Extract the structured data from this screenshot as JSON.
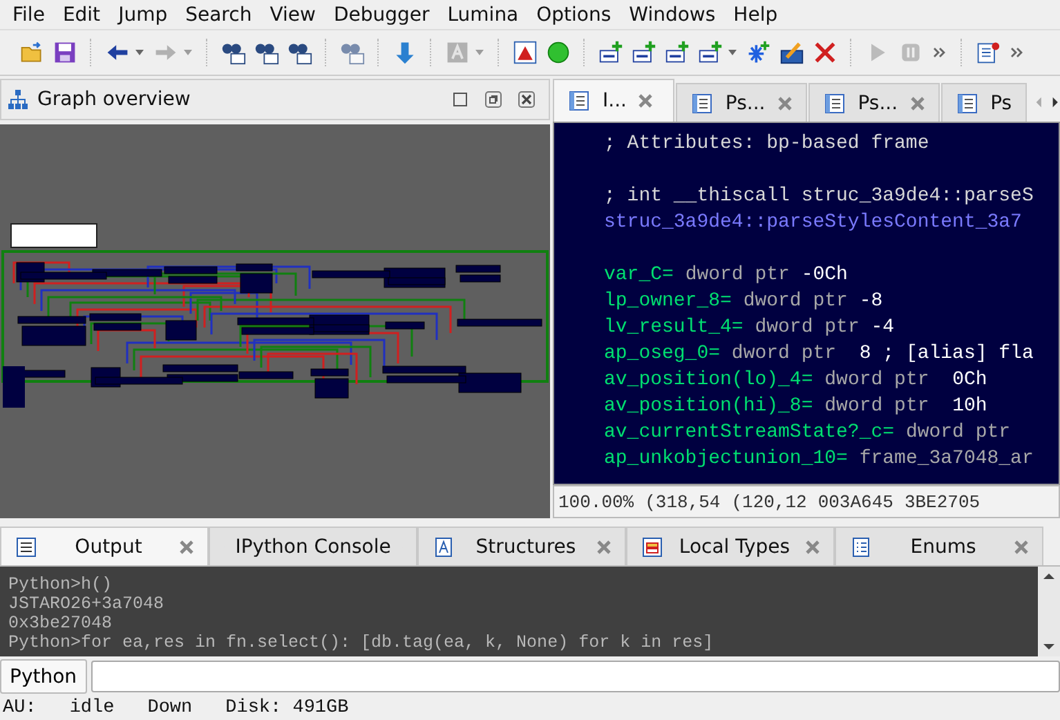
{
  "menu": [
    "File",
    "Edit",
    "Jump",
    "Search",
    "View",
    "Debugger",
    "Lumina",
    "Options",
    "Windows",
    "Help"
  ],
  "toolbar": [
    {
      "kind": "open",
      "disabled": false
    },
    {
      "kind": "save",
      "disabled": false
    },
    {
      "kind": "sep"
    },
    {
      "kind": "back",
      "disabled": false,
      "dropdown": true
    },
    {
      "kind": "forward",
      "disabled": true,
      "dropdown": true
    },
    {
      "kind": "sep"
    },
    {
      "kind": "find-hash",
      "disabled": false
    },
    {
      "kind": "find-text",
      "disabled": false
    },
    {
      "kind": "find-binary",
      "disabled": false
    },
    {
      "kind": "sep"
    },
    {
      "kind": "find-next",
      "disabled": true
    },
    {
      "kind": "sep"
    },
    {
      "kind": "jump-down",
      "disabled": false
    },
    {
      "kind": "sep"
    },
    {
      "kind": "letter",
      "disabled": true,
      "dropdown": true
    },
    {
      "kind": "sep"
    },
    {
      "kind": "warning",
      "disabled": false
    },
    {
      "kind": "green-dot",
      "disabled": false
    },
    {
      "kind": "sep"
    },
    {
      "kind": "add-code",
      "disabled": false
    },
    {
      "kind": "add-data",
      "disabled": false
    },
    {
      "kind": "add-text",
      "disabled": false
    },
    {
      "kind": "add-string",
      "disabled": false,
      "dropdown": true
    },
    {
      "kind": "add-star",
      "disabled": false
    },
    {
      "kind": "edit",
      "disabled": false
    },
    {
      "kind": "delete",
      "disabled": false
    },
    {
      "kind": "sep"
    },
    {
      "kind": "play",
      "disabled": true
    },
    {
      "kind": "pause",
      "disabled": true
    },
    {
      "kind": "more"
    },
    {
      "kind": "sep"
    },
    {
      "kind": "info",
      "disabled": false
    },
    {
      "kind": "more"
    }
  ],
  "graph_overview": {
    "title": "Graph overview"
  },
  "code_tabs": [
    {
      "label": "I...",
      "selected": true,
      "closable": true
    },
    {
      "label": "Ps...",
      "selected": false,
      "closable": true
    },
    {
      "label": "Ps...",
      "selected": false,
      "closable": true
    },
    {
      "label": "Ps",
      "selected": false,
      "closable": false
    }
  ],
  "code_lines": [
    {
      "kind": "code",
      "parts": [
        {
          "kind": "comment",
          "text": "; Attributes: bp-based frame"
        }
      ]
    },
    {
      "kind": "blank"
    },
    {
      "kind": "code",
      "parts": [
        {
          "kind": "comment",
          "text": "; int __thiscall struc_3a9de4::parseS"
        }
      ]
    },
    {
      "kind": "code",
      "parts": [
        {
          "kind": "function",
          "text": "struc_3a9de4::parseStylesContent_3a7"
        }
      ]
    },
    {
      "kind": "blank"
    },
    {
      "kind": "code",
      "parts": [
        {
          "kind": "name",
          "text": "var_C="
        },
        {
          "kind": "type",
          "text": " dword ptr "
        },
        {
          "kind": "value",
          "text": "-0Ch"
        }
      ]
    },
    {
      "kind": "code",
      "parts": [
        {
          "kind": "name",
          "text": "lp_owner_8="
        },
        {
          "kind": "type",
          "text": " dword ptr "
        },
        {
          "kind": "value",
          "text": "-8"
        }
      ]
    },
    {
      "kind": "code",
      "parts": [
        {
          "kind": "name",
          "text": "lv_result_4="
        },
        {
          "kind": "type",
          "text": " dword ptr "
        },
        {
          "kind": "value",
          "text": "-4"
        }
      ]
    },
    {
      "kind": "code",
      "parts": [
        {
          "kind": "name",
          "text": "ap_oseg_0="
        },
        {
          "kind": "type",
          "text": " dword ptr  "
        },
        {
          "kind": "value",
          "text": "8 ; [alias] fla"
        }
      ]
    },
    {
      "kind": "code",
      "parts": [
        {
          "kind": "name",
          "text": "av_position(lo)_4="
        },
        {
          "kind": "type",
          "text": " dword ptr  "
        },
        {
          "kind": "value",
          "text": "0Ch"
        }
      ]
    },
    {
      "kind": "code",
      "parts": [
        {
          "kind": "name",
          "text": "av_position(hi)_8="
        },
        {
          "kind": "type",
          "text": " dword ptr  "
        },
        {
          "kind": "value",
          "text": "10h"
        }
      ]
    },
    {
      "kind": "code",
      "parts": [
        {
          "kind": "name",
          "text": "av_currentStreamState?_c="
        },
        {
          "kind": "type",
          "text": " dword ptr"
        }
      ]
    },
    {
      "kind": "code",
      "parts": [
        {
          "kind": "name",
          "text": "ap_unkobjectunion_10="
        },
        {
          "kind": "type",
          "text": " frame_3a7048_ar"
        }
      ]
    }
  ],
  "code_status": [
    "100.00%",
    "(318,54",
    "(120,12",
    "003A645",
    "3BE2705"
  ],
  "bottom_tabs": [
    {
      "label": "Output",
      "selected": true
    },
    {
      "label": "IPython Console",
      "selected": false
    },
    {
      "label": "Structures",
      "selected": false
    },
    {
      "label": "Local Types",
      "selected": false
    },
    {
      "label": "Enums",
      "selected": false
    }
  ],
  "output_lines": [
    "Python>h()",
    "JSTARO26+3a7048",
    "0x3be27048",
    "Python>for ea,res in fn.select(): [db.tag(ea, k, None) for k in res]"
  ],
  "input": {
    "button": "Python"
  },
  "status_bar": [
    "AU:",
    "idle",
    "Down",
    "Disk: 491GB"
  ]
}
